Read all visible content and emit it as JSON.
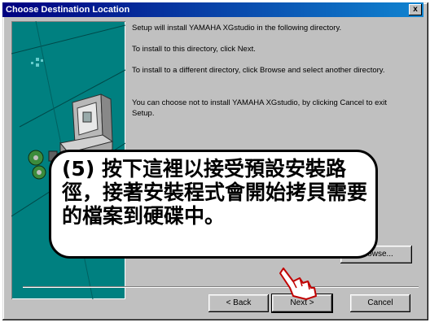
{
  "window": {
    "title": "Choose Destination Location",
    "close_glyph": "x"
  },
  "instructions": [
    "Setup will install YAMAHA XGstudio in the following directory.",
    "To install to this directory, click Next.",
    "To install to a different directory, click Browse and select another directory.",
    "You can choose not to install YAMAHA XGstudio, by clicking Cancel to exit Setup."
  ],
  "browse": {
    "label": "Browse..."
  },
  "buttons": {
    "back": "< Back",
    "next": "Next >",
    "cancel": "Cancel"
  },
  "callout": {
    "step": "(5)",
    "text": "按下這裡以接受預設安裝路徑，接著安裝程式會開始拷貝需要的檔案到硬碟中。"
  },
  "icons": {
    "setup_art": "computer-with-disks-icon",
    "pointer": "pointing-hand-icon"
  },
  "colors": {
    "titlebar": "#000080",
    "art_background": "#008080",
    "dialog": "#c0c0c0"
  }
}
